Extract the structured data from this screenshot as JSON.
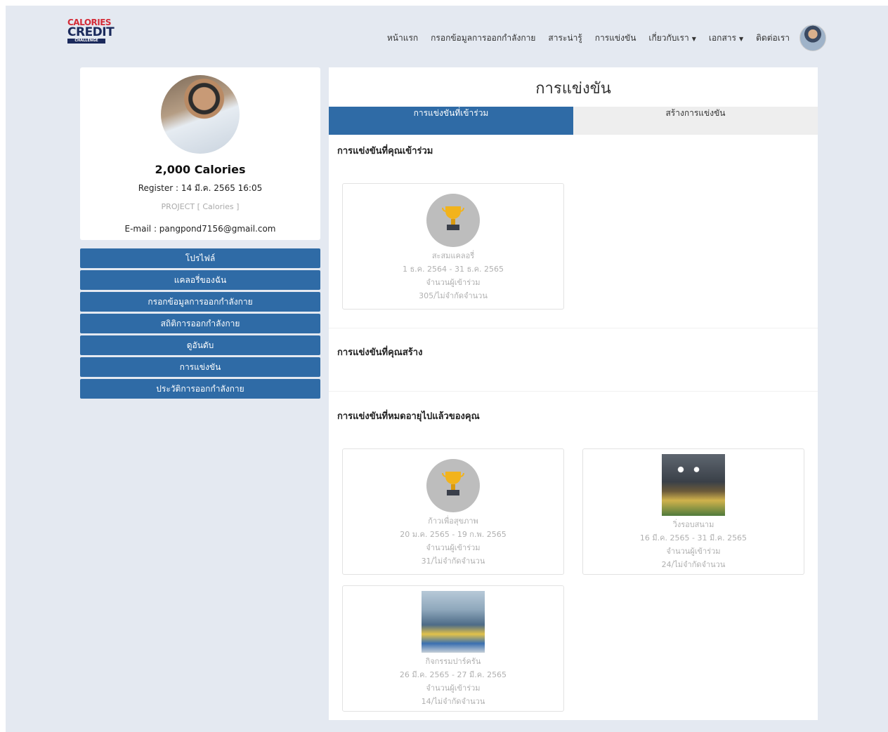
{
  "logo": {
    "line1": "CALORIES",
    "line2": "CREDIT",
    "line3": "CHALLENGE"
  },
  "nav": {
    "items": [
      "หน้าแรก",
      "กรอกข้อมูลการออกกำลังกาย",
      "สาระน่ารู้",
      "การแข่งขัน"
    ],
    "about": "เกี่ยวกับเรา",
    "documents": "เอกสาร",
    "contact": "ติดต่อเรา"
  },
  "profile": {
    "calories": "2,000 Calories",
    "register": "Register : 14 มี.ค. 2565 16:05",
    "project": "PROJECT [ Calories ]",
    "email": "E-mail : pangpond7156@gmail.com"
  },
  "side_menu": [
    "โปรไฟล์",
    "แคลอรี่ของฉัน",
    "กรอกข้อมูลการออกกำลังกาย",
    "สถิติการออกกำลังกาย",
    "ดูอันดับ",
    "การแข่งขัน",
    "ประวัติการออกกำลังกาย"
  ],
  "main": {
    "title": "การแข่งขัน",
    "tabs": [
      "การแข่งขันที่เข้าร่วม",
      "สร้างการแข่งขัน"
    ],
    "sections": {
      "joined": "การแข่งขันที่คุณเข้าร่วม",
      "created": "การแข่งขันที่คุณสร้าง",
      "expired": "การแข่งขันที่หมดอายุไปแล้วของคุณ"
    },
    "joined_cards": [
      {
        "name": "สะสมแคลอรี่",
        "dates": "1 ธ.ค. 2564 - 31 ธ.ค. 2565",
        "participants_label": "จำนวนผู้เข้าร่วม",
        "participants": "305/ไม่จำกัดจำนวน",
        "image": "trophy-icon"
      }
    ],
    "expired_cards": [
      {
        "name": "ก้าวเพื่อสุขภาพ",
        "dates": "20 ม.ค. 2565 - 19 ก.พ. 2565",
        "participants_label": "จำนวนผู้เข้าร่วม",
        "participants": "31/ไม่จำกัดจำนวน",
        "image": "trophy-icon"
      },
      {
        "name": "วิ่งรอบสนาม",
        "dates": "16 มี.ค. 2565 - 31 มี.ค. 2565",
        "participants_label": "จำนวนผู้เข้าร่วม",
        "participants": "24/ไม่จำกัดจำนวน",
        "image": "stadium-photo"
      },
      {
        "name": "กิจกรรมปาร์ครัน",
        "dates": "26 มี.ค. 2565 - 27 มี.ค. 2565",
        "participants_label": "จำนวนผู้เข้าร่วม",
        "participants": "14/ไม่จำกัดจำนวน",
        "image": "park-group-photo"
      }
    ]
  },
  "colors": {
    "primary": "#2f6ba6",
    "background": "#e4e9f1",
    "muted_text": "#b0b0b0"
  }
}
